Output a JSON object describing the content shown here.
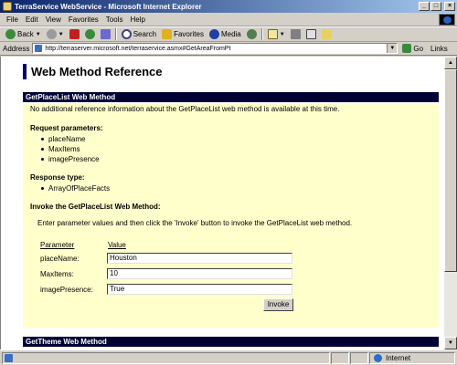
{
  "window": {
    "title": "TerraService WebService - Microsoft Internet Explorer"
  },
  "menu": [
    "File",
    "Edit",
    "View",
    "Favorites",
    "Tools",
    "Help"
  ],
  "toolbar": {
    "back": "Back",
    "search": "Search",
    "favorites": "Favorites",
    "media": "Media"
  },
  "address": {
    "label": "Address",
    "url": "http://terraserver.microsoft.net/terraservice.asmx#GetAreaFromPt",
    "go": "Go",
    "links": "Links"
  },
  "page": {
    "heading": "Web Method Reference",
    "method": {
      "title": "GetPlaceList Web Method",
      "note": "No additional reference information about the GetPlaceList web method is available at this time.",
      "request_label": "Request parameters:",
      "request_params": [
        "placeName",
        "MaxItems",
        "imagePresence"
      ],
      "response_label": "Response type:",
      "response_types": [
        "ArrayOfPlaceFacts"
      ],
      "invoke_heading": "Invoke the GetPlaceList Web Method:",
      "invoke_instructions": "Enter parameter values and then click the 'Invoke' button to invoke the GetPlaceList web method.",
      "table": {
        "col_param": "Parameter",
        "col_value": "Value",
        "rows": [
          {
            "label": "placeName:",
            "value": "Houston"
          },
          {
            "label": "MaxItems:",
            "value": "10"
          },
          {
            "label": "imagePresence:",
            "value": "True"
          }
        ]
      },
      "invoke_button": "Invoke"
    },
    "next_method": {
      "title": "GetTheme Web Method"
    }
  },
  "status": {
    "zone": "Internet"
  }
}
